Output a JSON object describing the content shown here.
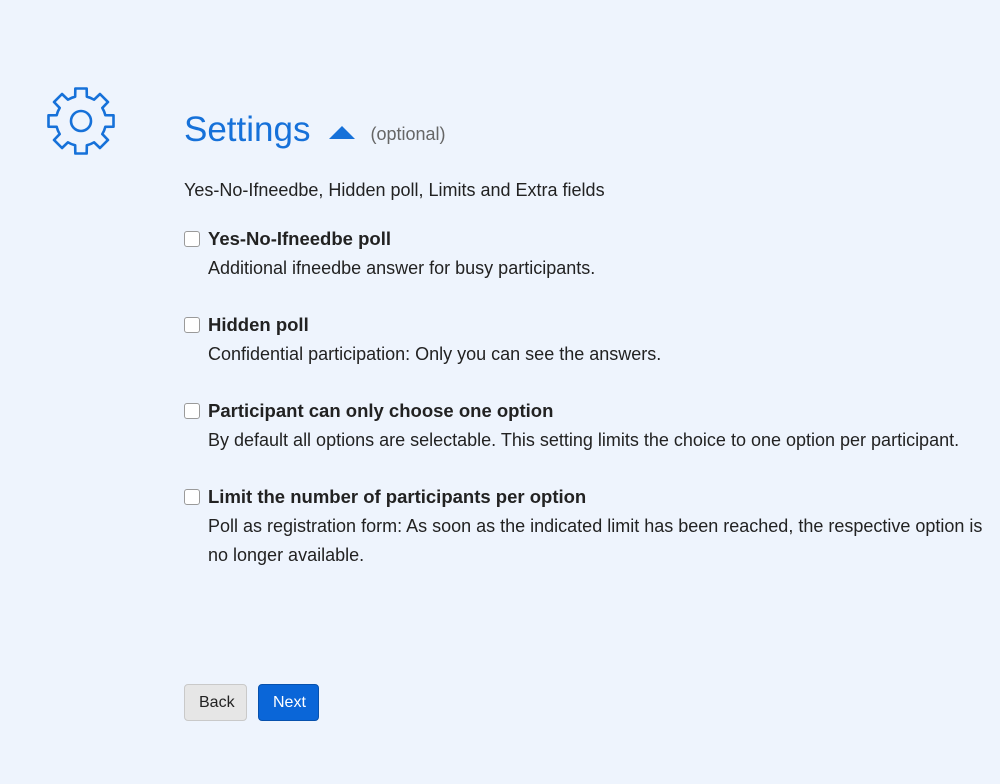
{
  "icons": {
    "settings": "gear-icon",
    "collapse": "triangle-up-icon"
  },
  "colors": {
    "background": "#eef4fd",
    "accent": "#1671d9",
    "primary_button": "#0a66d8"
  },
  "header": {
    "title": "Settings",
    "optional_label": "(optional)"
  },
  "summary": "Yes-No-Ifneedbe, Hidden poll, Limits and Extra fields",
  "options": [
    {
      "title": "Yes-No-Ifneedbe poll",
      "description": "Additional ifneedbe answer for busy participants.",
      "checked": false
    },
    {
      "title": "Hidden poll",
      "description": "Confidential participation: Only you can see the answers.",
      "checked": false
    },
    {
      "title": "Participant can only choose one option",
      "description": "By default all options are selectable. This setting limits the choice to one option per participant.",
      "checked": false
    },
    {
      "title": "Limit the number of participants per option",
      "description": "Poll as registration form: As soon as the indicated limit has been reached, the respective option is no longer available.",
      "checked": false
    }
  ],
  "buttons": {
    "back": "Back",
    "next": "Next"
  }
}
